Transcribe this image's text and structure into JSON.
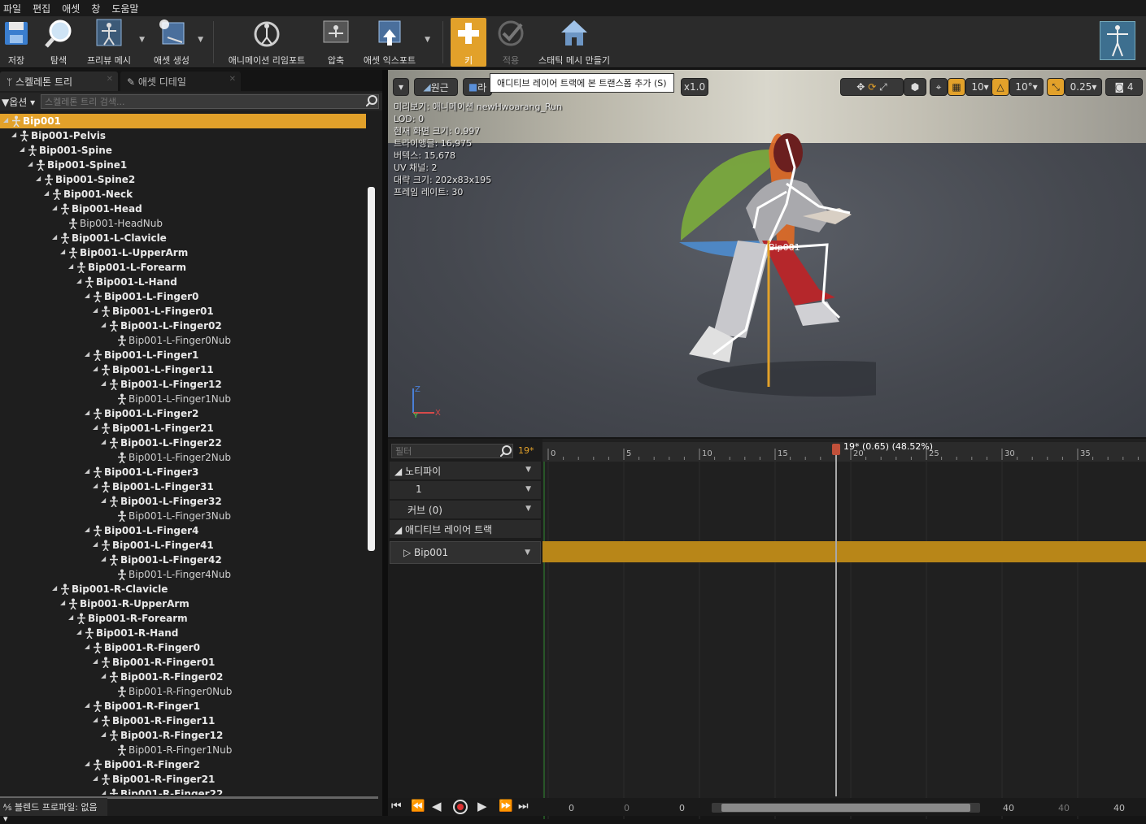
{
  "menu": [
    "파일",
    "편집",
    "애셋",
    "창",
    "도움말"
  ],
  "toolbar": {
    "save": "저장",
    "browse": "탐색",
    "preview_mesh": "프리뷰 메시",
    "create_asset": "애셋 생성",
    "reimport": "애니메이션 리임포트",
    "compress": "압축",
    "export_asset": "애셋 익스포트",
    "key": "키",
    "apply": "적용",
    "make_static_mesh": "스태틱 메시 만들기"
  },
  "tabs": {
    "skeleton_tree": "스켈레톤 트리",
    "asset_details": "애셋 디테일"
  },
  "tree_header": {
    "options": "옵션",
    "search_placeholder": "스켈레톤 트리 검색..."
  },
  "bones": [
    {
      "name": "Bip001",
      "depth": 0,
      "selected": true
    },
    {
      "name": "Bip001-Pelvis",
      "depth": 1
    },
    {
      "name": "Bip001-Spine",
      "depth": 2
    },
    {
      "name": "Bip001-Spine1",
      "depth": 3
    },
    {
      "name": "Bip001-Spine2",
      "depth": 4
    },
    {
      "name": "Bip001-Neck",
      "depth": 5
    },
    {
      "name": "Bip001-Head",
      "depth": 6
    },
    {
      "name": "Bip001-HeadNub",
      "depth": 7,
      "leaf": true
    },
    {
      "name": "Bip001-L-Clavicle",
      "depth": 6
    },
    {
      "name": "Bip001-L-UpperArm",
      "depth": 7
    },
    {
      "name": "Bip001-L-Forearm",
      "depth": 8
    },
    {
      "name": "Bip001-L-Hand",
      "depth": 9
    },
    {
      "name": "Bip001-L-Finger0",
      "depth": 10
    },
    {
      "name": "Bip001-L-Finger01",
      "depth": 11
    },
    {
      "name": "Bip001-L-Finger02",
      "depth": 12
    },
    {
      "name": "Bip001-L-Finger0Nub",
      "depth": 13,
      "leaf": true
    },
    {
      "name": "Bip001-L-Finger1",
      "depth": 10
    },
    {
      "name": "Bip001-L-Finger11",
      "depth": 11
    },
    {
      "name": "Bip001-L-Finger12",
      "depth": 12
    },
    {
      "name": "Bip001-L-Finger1Nub",
      "depth": 13,
      "leaf": true
    },
    {
      "name": "Bip001-L-Finger2",
      "depth": 10
    },
    {
      "name": "Bip001-L-Finger21",
      "depth": 11
    },
    {
      "name": "Bip001-L-Finger22",
      "depth": 12
    },
    {
      "name": "Bip001-L-Finger2Nub",
      "depth": 13,
      "leaf": true
    },
    {
      "name": "Bip001-L-Finger3",
      "depth": 10
    },
    {
      "name": "Bip001-L-Finger31",
      "depth": 11
    },
    {
      "name": "Bip001-L-Finger32",
      "depth": 12
    },
    {
      "name": "Bip001-L-Finger3Nub",
      "depth": 13,
      "leaf": true
    },
    {
      "name": "Bip001-L-Finger4",
      "depth": 10
    },
    {
      "name": "Bip001-L-Finger41",
      "depth": 11
    },
    {
      "name": "Bip001-L-Finger42",
      "depth": 12
    },
    {
      "name": "Bip001-L-Finger4Nub",
      "depth": 13,
      "leaf": true
    },
    {
      "name": "Bip001-R-Clavicle",
      "depth": 6
    },
    {
      "name": "Bip001-R-UpperArm",
      "depth": 7
    },
    {
      "name": "Bip001-R-Forearm",
      "depth": 8
    },
    {
      "name": "Bip001-R-Hand",
      "depth": 9
    },
    {
      "name": "Bip001-R-Finger0",
      "depth": 10
    },
    {
      "name": "Bip001-R-Finger01",
      "depth": 11
    },
    {
      "name": "Bip001-R-Finger02",
      "depth": 12
    },
    {
      "name": "Bip001-R-Finger0Nub",
      "depth": 13,
      "leaf": true
    },
    {
      "name": "Bip001-R-Finger1",
      "depth": 10
    },
    {
      "name": "Bip001-R-Finger11",
      "depth": 11
    },
    {
      "name": "Bip001-R-Finger12",
      "depth": 12
    },
    {
      "name": "Bip001-R-Finger1Nub",
      "depth": 13,
      "leaf": true
    },
    {
      "name": "Bip001-R-Finger2",
      "depth": 10
    },
    {
      "name": "Bip001-R-Finger21",
      "depth": 11
    },
    {
      "name": "Bip001-R-Finger22",
      "depth": 12
    }
  ],
  "blend_profile": "블렌드 프로파일: 없음",
  "viewport": {
    "perspective": "원근",
    "lit_prefix": "라",
    "speed": "x1.0",
    "grid_snap": "10",
    "rot_snap": "10°",
    "scale_snap": "0.25",
    "cam_speed": "4",
    "tooltip": "애디티브 레이어 트랙에 본 트랜스폼 추가 (S)",
    "stats": [
      "미리보기: 애니메이션 newHwoarang_Run",
      "LOD: 0",
      "현재 화면 크기: 0.997",
      "트라이앵글: 16,975",
      "버텍스: 15,678",
      "UV 채널: 2",
      "대략 크기: 202x83x195",
      "프레임 레이트: 30"
    ],
    "bone_label": "Bip001",
    "axis_z": "Z",
    "axis_y": "Y",
    "axis_x": "X"
  },
  "tracks": {
    "filter_placeholder": "필터",
    "frame": "19*",
    "notify": "노티파이",
    "notify_row": "1",
    "curves": "커브  (0)",
    "additive": "애디티브 레이어 트랙",
    "bone_track": "Bip001"
  },
  "timeline": {
    "ticks": [
      "0",
      "5",
      "10",
      "15",
      "20",
      "25",
      "30",
      "35"
    ],
    "playhead_label": "19* (0.65) (48.52%)",
    "range_left": [
      "0",
      "0",
      "0"
    ],
    "range_right": [
      "40",
      "40",
      "40"
    ]
  },
  "colors": {
    "accent": "#e2a12a",
    "track_bar": "#b88618"
  }
}
